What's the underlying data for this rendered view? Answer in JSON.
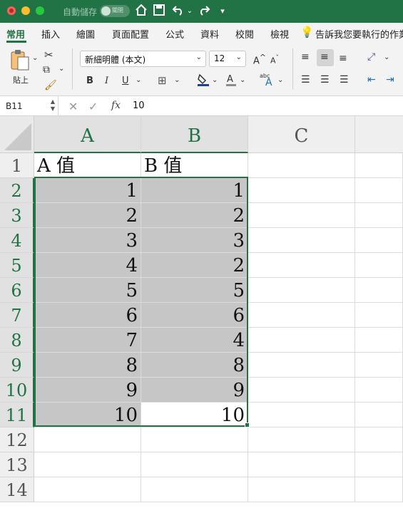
{
  "title_bar": {
    "autosave_label": "自動儲存",
    "autosave_state": "關閉"
  },
  "ribbon_tabs": [
    "常用",
    "插入",
    "繪圖",
    "頁面配置",
    "公式",
    "資料",
    "校閱",
    "檢視"
  ],
  "active_tab": "常用",
  "tell_me": "告訴我您要執行的作業",
  "ribbon": {
    "paste_label": "貼上",
    "font_name": "新細明體 (本文)",
    "font_size": "12",
    "bold": "B",
    "italic": "I",
    "underline": "U",
    "wrap_label": "abc"
  },
  "formula_bar": {
    "name_box": "B11",
    "fx_label": "fx",
    "value": "10"
  },
  "columns": [
    "A",
    "B",
    "C"
  ],
  "rows": [
    "1",
    "2",
    "3",
    "4",
    "5",
    "6",
    "7",
    "8",
    "9",
    "10",
    "11",
    "12",
    "13",
    "14"
  ],
  "headers": {
    "a": "A 值",
    "b": "B 值"
  },
  "data": [
    {
      "a": "1",
      "b": "1"
    },
    {
      "a": "2",
      "b": "2"
    },
    {
      "a": "3",
      "b": "3"
    },
    {
      "a": "4",
      "b": "2"
    },
    {
      "a": "5",
      "b": "5"
    },
    {
      "a": "6",
      "b": "6"
    },
    {
      "a": "7",
      "b": "4"
    },
    {
      "a": "8",
      "b": "8"
    },
    {
      "a": "9",
      "b": "9"
    },
    {
      "a": "10",
      "b": "10"
    }
  ],
  "colors": {
    "accent": "#217346",
    "selection_fill": "#c6c6c6"
  }
}
